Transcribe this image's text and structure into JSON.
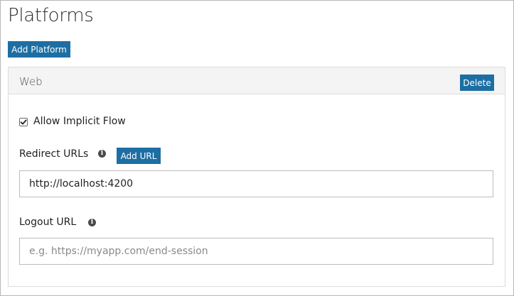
{
  "page": {
    "title": "Platforms",
    "add_platform_label": "Add Platform"
  },
  "platform": {
    "name": "Web",
    "delete_label": "Delete",
    "allow_implicit_flow": {
      "label": "Allow Implicit Flow",
      "checked": true
    },
    "redirect_urls": {
      "label": "Redirect URLs",
      "add_url_label": "Add URL",
      "info_icon": "info-icon",
      "values": [
        "http://localhost:4200"
      ]
    },
    "logout_url": {
      "label": "Logout URL",
      "info_icon": "info-icon",
      "value": "",
      "placeholder": "e.g. https://myapp.com/end-session"
    }
  },
  "colors": {
    "primary_button": "#1d6fa3",
    "panel_header_bg": "#f4f4f4"
  }
}
